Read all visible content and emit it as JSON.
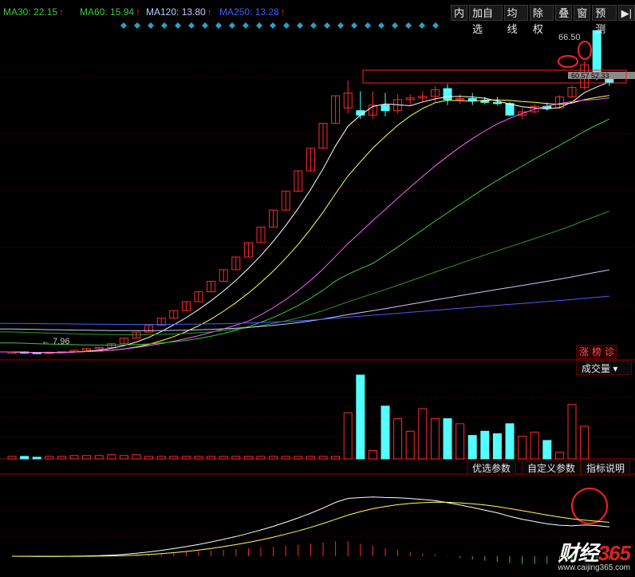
{
  "ma_legend": [
    {
      "label": "MA30: 22.15",
      "color": "#3dc83d",
      "arrow": "↑"
    },
    {
      "label": "MA60: 15.94",
      "color": "#3dc83d",
      "arrow": "↑"
    },
    {
      "label": "MA120: 13.80",
      "color": "#c8c8ff",
      "arrow": "↑"
    },
    {
      "label": "MA250: 13.28",
      "color": "#4a5cff",
      "arrow": "↑"
    }
  ],
  "toolbar": [
    "内",
    "加自选",
    "均线",
    "除权",
    "叠",
    "窗",
    "预测",
    "▶|"
  ],
  "price_labels": {
    "high": "66.50",
    "low": "7.96",
    "last": "60.57 52.33"
  },
  "zbz": [
    "涨",
    "榜",
    "诊"
  ],
  "volume_panel": {
    "selector": "成交量 ▾"
  },
  "indicator_buttons": [
    "优选参数",
    "自定义参数",
    "指标说明"
  ],
  "logo": {
    "brand": "财经",
    "num": "365",
    "url": "www.caijing365.com"
  },
  "colors": {
    "up": "#ff2a2a",
    "down": "#54ffff",
    "ma5": "#ffffff",
    "ma10": "#ffff60",
    "ma20": "#ff60ff",
    "ma30": "#3dc83d",
    "ma60": "#3dc83d",
    "ma120": "#c8c8ff",
    "ma250": "#4a5cff",
    "grid": "#6b0000",
    "circle": "#ff2020"
  },
  "chart_data": {
    "type": "candlestick",
    "candles": [
      {
        "o": 8.2,
        "h": 8.4,
        "l": 8.0,
        "c": 8.3
      },
      {
        "o": 8.3,
        "h": 8.4,
        "l": 8.1,
        "c": 8.2
      },
      {
        "o": 8.2,
        "h": 8.3,
        "l": 7.96,
        "c": 8.0
      },
      {
        "o": 8.0,
        "h": 8.3,
        "l": 7.96,
        "c": 8.25
      },
      {
        "o": 8.25,
        "h": 8.4,
        "l": 8.1,
        "c": 8.35
      },
      {
        "o": 8.35,
        "h": 8.6,
        "l": 8.3,
        "c": 8.6
      },
      {
        "o": 8.6,
        "h": 8.9,
        "l": 8.5,
        "c": 8.9
      },
      {
        "o": 8.9,
        "h": 9.2,
        "l": 8.8,
        "c": 9.1
      },
      {
        "o": 9.1,
        "h": 9.8,
        "l": 9.1,
        "c": 9.8
      },
      {
        "o": 9.8,
        "h": 10.8,
        "l": 9.8,
        "c": 10.8
      },
      {
        "o": 10.8,
        "h": 11.9,
        "l": 10.8,
        "c": 11.9
      },
      {
        "o": 11.9,
        "h": 13.1,
        "l": 11.9,
        "c": 13.1
      },
      {
        "o": 13.1,
        "h": 14.4,
        "l": 13.1,
        "c": 14.4
      },
      {
        "o": 14.4,
        "h": 15.8,
        "l": 14.4,
        "c": 15.8
      },
      {
        "o": 15.8,
        "h": 17.4,
        "l": 15.8,
        "c": 17.4
      },
      {
        "o": 17.4,
        "h": 19.2,
        "l": 17.4,
        "c": 19.2
      },
      {
        "o": 19.2,
        "h": 21.1,
        "l": 19.2,
        "c": 21.1
      },
      {
        "o": 21.1,
        "h": 23.2,
        "l": 21.1,
        "c": 23.2
      },
      {
        "o": 23.2,
        "h": 25.5,
        "l": 23.2,
        "c": 25.5
      },
      {
        "o": 25.5,
        "h": 28.1,
        "l": 25.5,
        "c": 28.1
      },
      {
        "o": 28.1,
        "h": 30.9,
        "l": 28.1,
        "c": 30.9
      },
      {
        "o": 30.9,
        "h": 34.0,
        "l": 30.9,
        "c": 34.0
      },
      {
        "o": 34.0,
        "h": 37.4,
        "l": 34.0,
        "c": 37.4
      },
      {
        "o": 37.4,
        "h": 41.1,
        "l": 37.4,
        "c": 41.1
      },
      {
        "o": 41.1,
        "h": 45.2,
        "l": 41.1,
        "c": 45.2
      },
      {
        "o": 45.2,
        "h": 49.7,
        "l": 45.2,
        "c": 49.7
      },
      {
        "o": 49.7,
        "h": 54.7,
        "l": 49.7,
        "c": 54.7
      },
      {
        "o": 52.5,
        "h": 57.5,
        "l": 51.5,
        "c": 55.2
      },
      {
        "o": 52.0,
        "h": 55.5,
        "l": 50.5,
        "c": 51.2
      },
      {
        "o": 51.2,
        "h": 55.5,
        "l": 50.5,
        "c": 53.0
      },
      {
        "o": 53.0,
        "h": 55.2,
        "l": 51.0,
        "c": 52.0
      },
      {
        "o": 52.0,
        "h": 55.0,
        "l": 51.5,
        "c": 54.0
      },
      {
        "o": 54.0,
        "h": 55.0,
        "l": 53.0,
        "c": 54.3
      },
      {
        "o": 54.3,
        "h": 55.5,
        "l": 53.5,
        "c": 54.6
      },
      {
        "o": 54.6,
        "h": 56.5,
        "l": 53.5,
        "c": 55.8
      },
      {
        "o": 56.0,
        "h": 56.8,
        "l": 53.0,
        "c": 54.0
      },
      {
        "o": 54.0,
        "h": 55.0,
        "l": 53.2,
        "c": 54.2
      },
      {
        "o": 54.2,
        "h": 55.2,
        "l": 53.0,
        "c": 53.8
      },
      {
        "o": 53.8,
        "h": 54.5,
        "l": 53.2,
        "c": 53.5
      },
      {
        "o": 53.5,
        "h": 54.5,
        "l": 53.0,
        "c": 53.3
      },
      {
        "o": 53.3,
        "h": 53.6,
        "l": 51.0,
        "c": 51.2
      },
      {
        "o": 51.2,
        "h": 52.5,
        "l": 50.5,
        "c": 51.8
      },
      {
        "o": 51.8,
        "h": 53.2,
        "l": 51.5,
        "c": 52.8
      },
      {
        "o": 52.8,
        "h": 53.5,
        "l": 52.0,
        "c": 52.5
      },
      {
        "o": 52.5,
        "h": 54.8,
        "l": 52.3,
        "c": 54.5
      },
      {
        "o": 54.5,
        "h": 56.5,
        "l": 54.3,
        "c": 56.2
      },
      {
        "o": 56.2,
        "h": 61.0,
        "l": 55.8,
        "c": 60.3
      },
      {
        "o": 66.5,
        "h": 66.5,
        "l": 57.5,
        "c": 58.0
      },
      {
        "o": 57.8,
        "h": 58.5,
        "l": 56.5,
        "c": 57.0
      }
    ],
    "volume": [
      3,
      3,
      2,
      3,
      3,
      4,
      4,
      4,
      5,
      4,
      5,
      3,
      3,
      3,
      3,
      3,
      3,
      3,
      3,
      3,
      3,
      3,
      3,
      3,
      3,
      3,
      3,
      55,
      100,
      10,
      63,
      48,
      33,
      60,
      48,
      48,
      42,
      28,
      33,
      30,
      42,
      27,
      32,
      22,
      8,
      65,
      39
    ]
  }
}
